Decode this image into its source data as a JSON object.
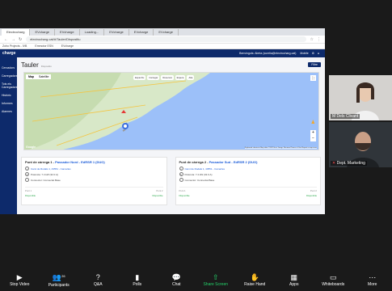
{
  "browser": {
    "tabs": [
      "Electrocharg",
      "EVcharge",
      "EVcharge",
      "Loading...",
      "EVcharge",
      "EVcharge",
      "EVcharge"
    ],
    "active_tab": 0,
    "url": "electrocharg.cat/#/Tauler/Dispositiu",
    "bookmarks": [
      "Zoho Projects - IVB",
      "Emmotor ESN",
      "EVcharge"
    ]
  },
  "app": {
    "logo": "charge",
    "user": "Benvinguts: Alerta (surelia@electrocharg.cat)",
    "mobile": "Mobile",
    "sidebar": [
      "Cercadors",
      "Carregadors",
      "Tots els Carregadors",
      "Històric",
      "Informes",
      "Alarmes"
    ],
    "page_title": "Tauler",
    "page_subtitle": "Dispositiu",
    "filter_label": "Filtre",
    "map": {
      "type_map": "Map",
      "type_satellite": "Satellite",
      "chips": [
        "Espai Iliu",
        "Carregar",
        "Reservat",
        "Espera",
        "Alta"
      ],
      "attribution": "Keyboard shortcuts  Map data ©2023 Inst. Geogr. Nacional  Terms of Use  Report a map error",
      "google": "Google"
    },
    "cards": [
      {
        "title_prefix": "Punt de càrrega 1",
        "title_link": "Passador Nord - EdRSR 1 (DUO)",
        "address": "Camí de Rodals 1, 43551 - Camarles",
        "power": "Potència: 7.4 kW (32.0 A)",
        "connector": "Connector: Connectat Base",
        "col1": "Punt 1",
        "col2": "Punt 2",
        "status1": "Disponible",
        "status2": "Disponible"
      },
      {
        "title_prefix": "Punt de càrrega 2",
        "title_link": "Passador Sud - EdRSR 2 (DUO)",
        "address": "Camí de Rodals 1, 43551 - Camarles",
        "power": "Potència: 7.4 kW (32.0 A)",
        "connector": "Connector: Connectat Base",
        "col1": "Punt 1",
        "col2": "Punt 2",
        "status1": "Disponible",
        "status2": "Disponible"
      }
    ]
  },
  "zoom": {
    "participant_top": "electric",
    "participant1": "M Dels Clivant",
    "participant2": "Dept. Marketing",
    "toolbar": [
      {
        "label": "Stop Video",
        "icon": "video-icon"
      },
      {
        "label": "Participants",
        "icon": "participants-icon",
        "count": "26"
      },
      {
        "label": "Q&A",
        "icon": "qa-icon"
      },
      {
        "label": "Polls",
        "icon": "polls-icon"
      },
      {
        "label": "Chat",
        "icon": "chat-icon"
      },
      {
        "label": "Share Screen",
        "icon": "share-screen-icon"
      },
      {
        "label": "Raise Hand",
        "icon": "raise-hand-icon"
      },
      {
        "label": "Apps",
        "icon": "apps-icon"
      },
      {
        "label": "Whiteboards",
        "icon": "whiteboards-icon"
      },
      {
        "label": "More",
        "icon": "more-icon"
      }
    ],
    "share_color": "#24d16a"
  }
}
